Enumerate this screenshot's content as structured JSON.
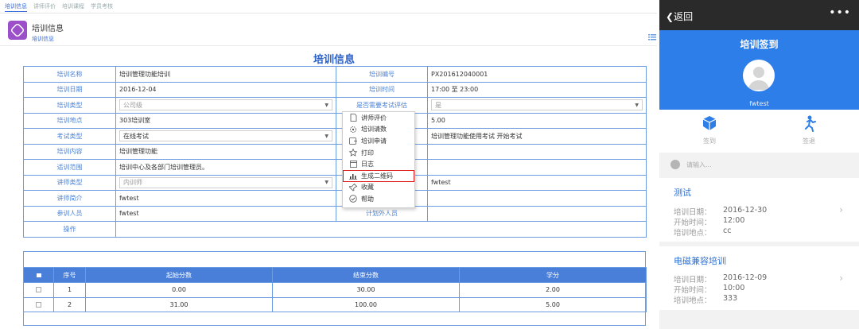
{
  "desk": {
    "tabs": [
      "培训信息",
      "讲师评价",
      "培训课程",
      "学员考核"
    ],
    "header": {
      "title": "培训信息",
      "subtitle": "培训信息"
    },
    "form_title": "培训信息",
    "rows": {
      "name_label": "培训名称",
      "name_value": "培训管理功能培训",
      "code_label": "培训编号",
      "code_value": "PX201612040001",
      "date_label": "培训日期",
      "date_value": "2016-12-04",
      "time_label": "培训时间",
      "time_value": "17:00 至 23:00",
      "type_label": "培训类型",
      "type_value": "公司级",
      "eval_label": "是否需要考试评估",
      "eval_value": "是",
      "place_label": "培训地点",
      "place_value": "303培训室",
      "score_value": "5.00",
      "exam_label": "考试类型",
      "exam_value": "在线考试",
      "exam_desc": "培训管理功能使用考试 开始考试",
      "content_label": "培训内容",
      "content_value": "培训管理功能",
      "scope_label": "适训范围",
      "scope_value": "培训中心及各部门培训管理员。",
      "lecturer_type_label": "讲师类型",
      "lecturer_type_value": "内训师",
      "lecturer_value": "fwtest",
      "lecturer_intro_label": "讲师简介",
      "lecturer_intro_value": "fwtest",
      "participants_label": "参训人员",
      "participants_value": "fwtest",
      "extra_label": "计划外人员",
      "ops_label": "操作"
    },
    "menu": [
      {
        "label": "讲师评价",
        "icon": "document-icon"
      },
      {
        "label": "培训请数",
        "icon": "gear-icon"
      },
      {
        "label": "培训申请",
        "icon": "form-icon"
      },
      {
        "label": "打印",
        "icon": "star-icon"
      },
      {
        "label": "日志",
        "icon": "calendar-icon"
      },
      {
        "label": "生成二维码",
        "icon": "chart-icon"
      },
      {
        "label": "收藏",
        "icon": "pin-icon"
      },
      {
        "label": "帮助",
        "icon": "check-circle-icon"
      }
    ],
    "score_table": {
      "headers": [
        "",
        "序号",
        "起始分数",
        "结束分数",
        "学分"
      ],
      "rows": [
        {
          "no": "1",
          "start": "0.00",
          "end": "30.00",
          "credit": "2.00"
        },
        {
          "no": "2",
          "start": "31.00",
          "end": "100.00",
          "credit": "5.00"
        }
      ]
    }
  },
  "mobile": {
    "back_label": "返回",
    "more_label": "•••",
    "hero_title": "培训签到",
    "username": "fwtest",
    "actions": [
      "签到",
      "签退"
    ],
    "search_placeholder": "请输入...",
    "cards": [
      {
        "title": "测试",
        "date_k": "培训日期：",
        "date_v": "2016-12-30",
        "time_k": "开始时间：",
        "time_v": "12:00",
        "place_k": "培训地点：",
        "place_v": "cc"
      },
      {
        "title": "电磁兼容培训",
        "date_k": "培训日期：",
        "date_v": "2016-12-09",
        "time_k": "开始时间：",
        "time_v": "10:00",
        "place_k": "培训地点：",
        "place_v": "333"
      }
    ]
  },
  "colors": {
    "accent": "#2d7ee8",
    "header_blue": "#4a7fd9",
    "highlight": "#e02020",
    "app_icon": "#9b4fc8"
  }
}
